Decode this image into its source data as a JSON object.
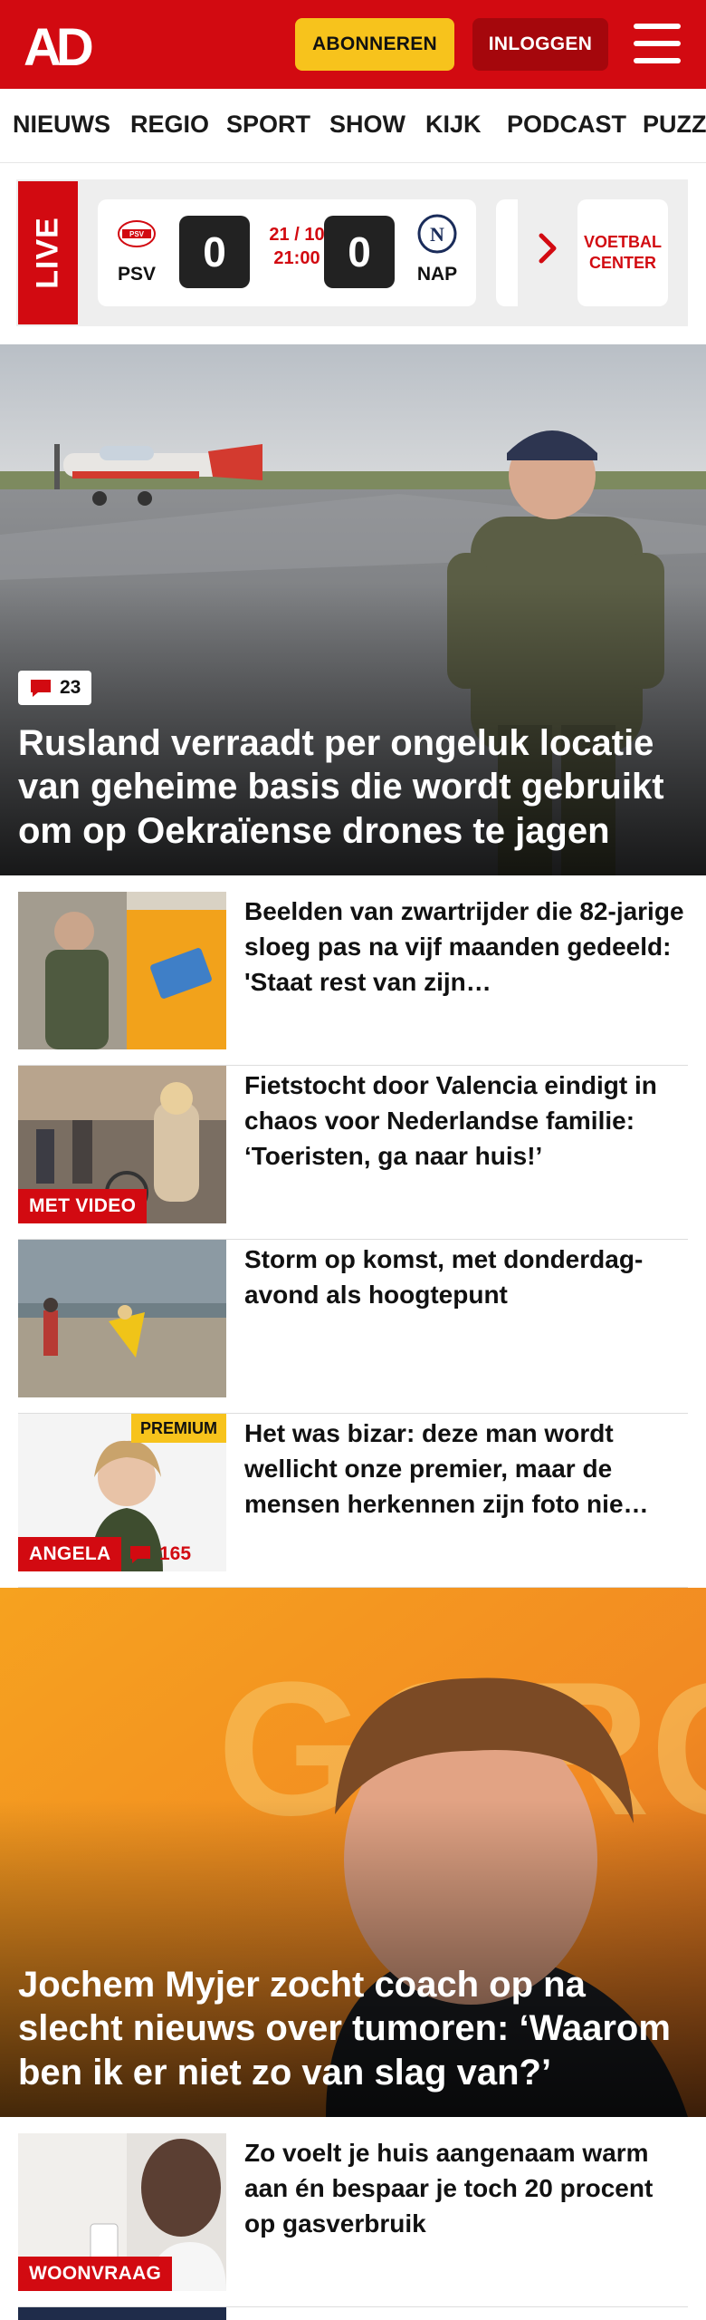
{
  "header": {
    "logo": "AD",
    "subscribe_label": "ABONNEREN",
    "login_label": "INLOGGEN"
  },
  "nav": {
    "items": [
      "NIEUWS",
      "REGIO",
      "SPORT",
      "SHOW",
      "KIJK",
      "PODCAST",
      "PUZZ"
    ]
  },
  "live": {
    "label": "LIVE",
    "match": {
      "home": "PSV",
      "away": "NAP",
      "home_score": "0",
      "away_score": "0",
      "date": "21 / 10",
      "time": "21:00"
    },
    "center_label_line1": "VOETBAL",
    "center_label_line2": "CENTER"
  },
  "hero": {
    "comments": "23",
    "title": "Rusland verraadt per ongeluk locatie van geheime basis die wordt gebruikt om op Oekraïense drones te jagen"
  },
  "articles": [
    {
      "title": "Beelden van zwartrijder die 82-jarige sloeg pas na vijf maanden gedeeld: 'Staat rest van zijn…"
    },
    {
      "title": "Fietstocht door Valencia eindigt in chaos voor Nederlandse familie: ‘Toeristen, ga naar huis!’",
      "tag": "MET VIDEO"
    },
    {
      "title": "Storm op komst, met donderdag­avond als hoogtepunt"
    },
    {
      "title": "Het was bizar: deze man wordt wellicht onze premier, maar de mensen herkennen zijn foto nie…",
      "tag": "ANGELA",
      "premium": "PREMIUM",
      "comments": "165"
    }
  ],
  "hero2": {
    "title": "Jochem Myjer zocht coach op na slecht nieuws over tumoren: ‘Waarom ben ik er niet zo van slag van?’"
  },
  "article_bottom": {
    "title": "Zo voelt je huis aangenaam warm aan én bespaar je toch 20 procent op gasverbruik",
    "tag": "WOONVRAAG"
  },
  "colors": {
    "brand_red": "#d20a11",
    "subscribe_yellow": "#f7c31c",
    "login_dark_red": "#a5070c"
  }
}
